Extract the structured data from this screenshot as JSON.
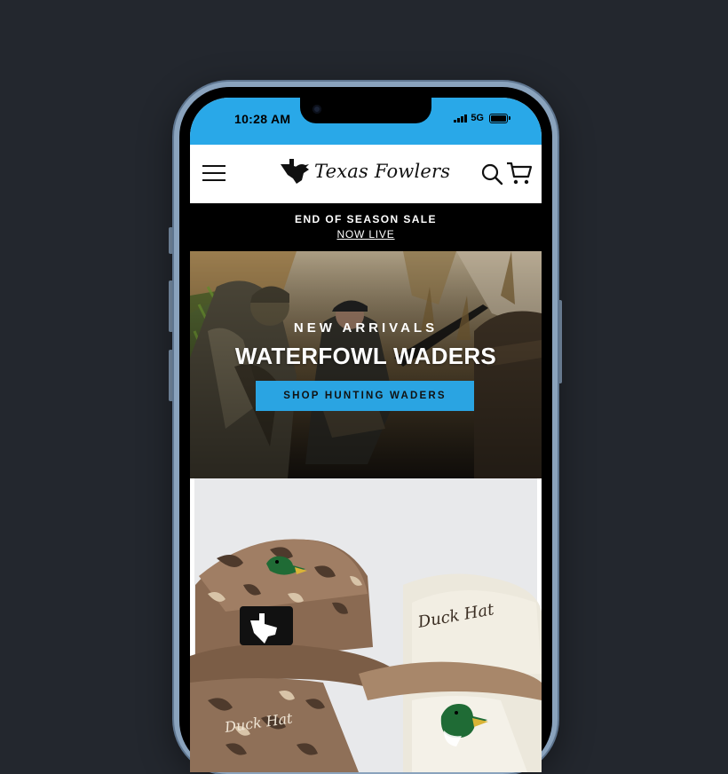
{
  "status_bar": {
    "time": "10:28 AM",
    "network": "5G",
    "signal_icon": "signal-icon",
    "battery_icon": "battery-icon"
  },
  "header": {
    "menu_icon": "menu-icon",
    "logo_text": "Texas Fowlers",
    "search_icon": "search-icon",
    "cart_icon": "cart-icon"
  },
  "announcement": {
    "title": "END OF SEASON SALE",
    "link": "NOW LIVE"
  },
  "hero": {
    "kicker": "NEW ARRIVALS",
    "title": "WATERFOWL WADERS",
    "button_label": "SHOP HUNTING WADERS"
  },
  "product_image": {
    "hat_text_1": "Duck Hat",
    "hat_text_2": "Duck Hat"
  },
  "colors": {
    "status_bar": "#29a8e8",
    "accent_button": "#2aa4e2",
    "announcement_bg": "#000000",
    "page_bg": "#23272e"
  }
}
